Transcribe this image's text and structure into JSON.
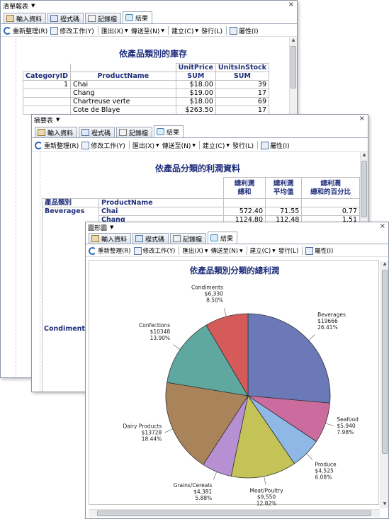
{
  "tabs": [
    {
      "label": "輸入資料",
      "icon": "input-data-icon"
    },
    {
      "label": "程式碼",
      "icon": "code-icon"
    },
    {
      "label": "記錄檔",
      "icon": "log-icon"
    },
    {
      "label": "結果",
      "icon": "results-icon"
    }
  ],
  "toolbar": {
    "refresh": "重新整理(R)",
    "modify": "修改工作(Y)",
    "export": "匯出(X)",
    "send_to": "傳送至(N)",
    "create": "建立(C)",
    "publish": "發行(L)",
    "properties": "屬性(I)"
  },
  "window1": {
    "title": "清單報表",
    "report_title": "依產品類別的庫存",
    "headers": {
      "unit_price": "UnitPrice",
      "units_in_stock": "UnitsInStock",
      "category_id": "CategoryID",
      "product_name": "ProductName",
      "sum": "SUM"
    },
    "rows": [
      {
        "category_id": "1",
        "product": "Chai",
        "price": "$18.00",
        "stock": "39"
      },
      {
        "category_id": "",
        "product": "Chang",
        "price": "$19.00",
        "stock": "17"
      },
      {
        "category_id": "",
        "product": "Chartreuse verte",
        "price": "$18.00",
        "stock": "69"
      },
      {
        "category_id": "",
        "product": "Cote de Blaye",
        "price": "$263.50",
        "stock": "17"
      }
    ]
  },
  "window2": {
    "title": "摘要表",
    "report_title": "依產品分類的利潤資料",
    "headers": {
      "profit_sum_1": "總利潤",
      "profit_sum_2": "總和",
      "profit_avg_1": "總利潤",
      "profit_avg_2": "平均值",
      "profit_pct_1": "總利潤",
      "profit_pct_2": "總和的百分比",
      "category": "產品類別",
      "product_name": "ProductName"
    },
    "groups": [
      {
        "category": "Beverages",
        "rows": [
          {
            "product": "Chai",
            "sum": "572.40",
            "avg": "71.55",
            "pct": "0.77"
          },
          {
            "product": "Chang",
            "sum": "1124.80",
            "avg": "112.48",
            "pct": "1.51"
          }
        ]
      },
      {
        "category": "Condiments",
        "rows": []
      }
    ]
  },
  "window3": {
    "title": "圖形圖"
  },
  "chart_data": {
    "type": "pie",
    "title": "依產品類別分類的總利潤",
    "slices": [
      {
        "label": "Beverages",
        "value_text": "$19666",
        "pct_text": "26.41%",
        "value": 19666,
        "color": "#6b79b8"
      },
      {
        "label": "Seafood",
        "value_text": "$5,940",
        "pct_text": "7.98%",
        "value": 5940,
        "color": "#cc6b9d"
      },
      {
        "label": "Produce",
        "value_text": "$4,525",
        "pct_text": "6.08%",
        "value": 4525,
        "color": "#8fb8e6"
      },
      {
        "label": "Meat/Poultry",
        "value_text": "$9,550",
        "pct_text": "12.82%",
        "value": 9550,
        "color": "#c3c357"
      },
      {
        "label": "Grains/Cereals",
        "value_text": "$4,381",
        "pct_text": "5.88%",
        "value": 4381,
        "color": "#b690d3"
      },
      {
        "label": "Dairy Products",
        "value_text": "$13728",
        "pct_text": "18.44%",
        "value": 13728,
        "color": "#a98359"
      },
      {
        "label": "Confections",
        "value_text": "$10348",
        "pct_text": "13.90%",
        "value": 10348,
        "color": "#5fa89f"
      },
      {
        "label": "Condiments",
        "value_text": "$6,330",
        "pct_text": "8.50%",
        "value": 6330,
        "color": "#d55b5b"
      }
    ]
  }
}
